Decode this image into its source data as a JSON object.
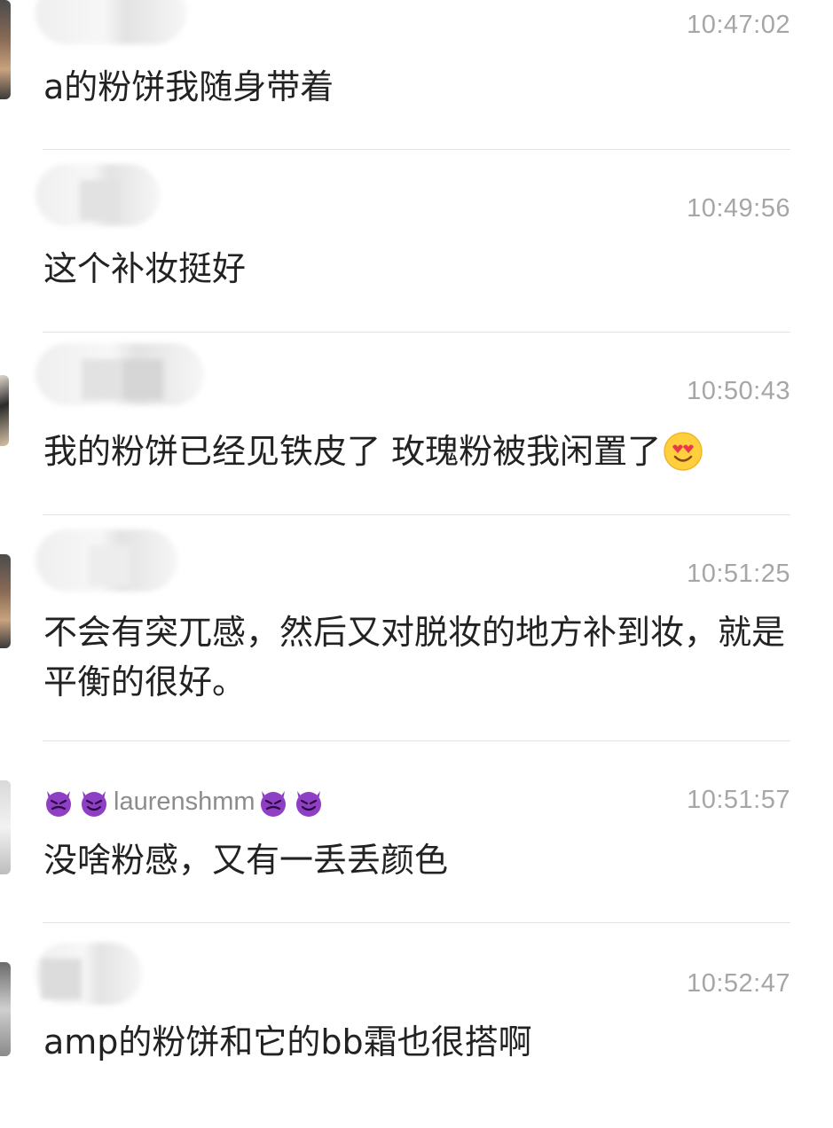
{
  "messages": [
    {
      "time": "10:47:02",
      "text": "a的粉饼我随身带着"
    },
    {
      "time": "10:49:56",
      "text": "这个补妆挺好"
    },
    {
      "time": "10:50:43",
      "text": "我的粉饼已经见铁皮了 玫瑰粉被我闲置了"
    },
    {
      "time": "10:51:25",
      "text": "不会有突兀感，然后又对脱妆的地方补到妆，就是平衡的很好。"
    },
    {
      "time": "10:51:57",
      "text": "没啥粉感，又有一丢丢颜色",
      "username": "laurenshmm"
    },
    {
      "time": "10:52:47",
      "text": "amp的粉饼和它的bb霜也很搭啊"
    }
  ],
  "icons": {
    "emoji_after_message_3": "smiling-face-with-heart-eyes-icon",
    "username_decoration": "smiling-devil-icon"
  },
  "colors": {
    "timestamp": "#a6a6a6",
    "message_text": "#222222",
    "divider": "#e2e2e2",
    "devil_purple": "#8e3fc4"
  }
}
